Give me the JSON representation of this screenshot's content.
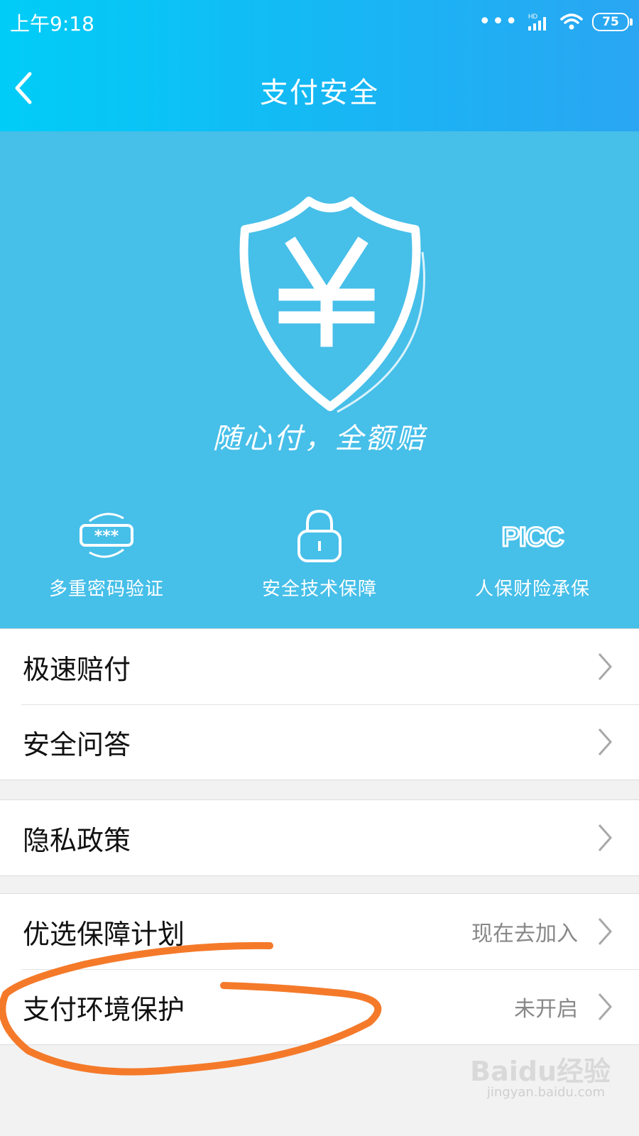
{
  "status_bar": {
    "time": "上午9:18",
    "battery": "75",
    "network": "HD"
  },
  "header": {
    "title": "支付安全"
  },
  "banner": {
    "slogan": "随心付，全额赔",
    "features": [
      {
        "label": "多重密码验证",
        "icon": "password-icon"
      },
      {
        "label": "安全技术保障",
        "icon": "lock-icon"
      },
      {
        "label": "人保财险承保",
        "icon": "picc-logo",
        "logo_text": "PICC"
      }
    ]
  },
  "list": {
    "group1": [
      {
        "label": "极速赔付"
      },
      {
        "label": "安全问答"
      }
    ],
    "group2": [
      {
        "label": "隐私政策"
      }
    ],
    "group3": [
      {
        "label": "优选保障计划",
        "value": "现在去加入"
      },
      {
        "label": "支付环境保护",
        "value": "未开启"
      }
    ]
  },
  "watermark": {
    "text": "Baidu经验",
    "sub": "jingyan.baidu.com"
  },
  "colors": {
    "header_start": "#00cdf7",
    "banner": "#46bfe9",
    "annotation": "#f47a2a"
  }
}
